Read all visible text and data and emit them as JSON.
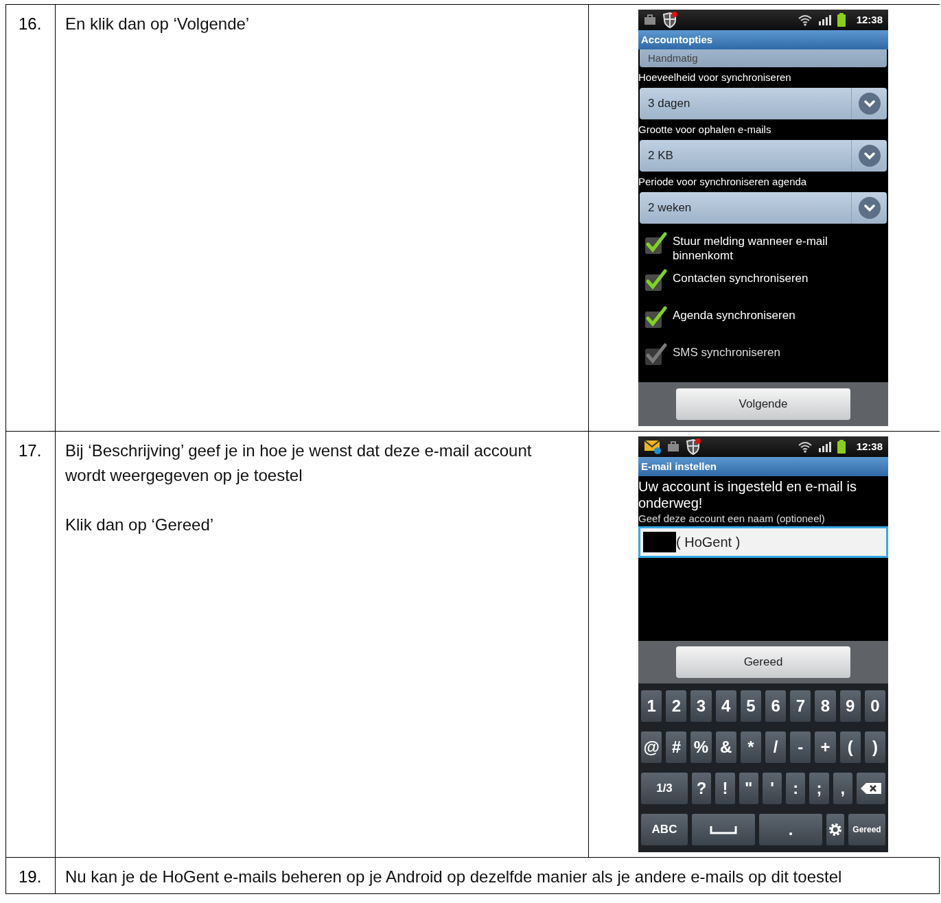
{
  "steps": [
    {
      "number": "16.",
      "paragraphs": [
        "En klik dan op ‘Volgende’"
      ],
      "phone": {
        "kind": "options",
        "time": "12:38",
        "notification_mail": false,
        "title": "Accountopties",
        "top_spinner": "Handmatig",
        "spinners": [
          {
            "label": "Hoeveelheid voor synchroniseren",
            "value": "3 dagen"
          },
          {
            "label": "Grootte voor ophalen e-mails",
            "value": "2 KB"
          },
          {
            "label": "Periode voor synchroniseren agenda",
            "value": "2 weken"
          }
        ],
        "checkboxes": [
          {
            "label": "Stuur melding wanneer e-mail binnenkomt",
            "checked": true,
            "disabled": false
          },
          {
            "label": "Contacten synchroniseren",
            "checked": true,
            "disabled": false
          },
          {
            "label": "Agenda synchroniseren",
            "checked": true,
            "disabled": false
          },
          {
            "label": "SMS synchroniseren",
            "checked": true,
            "disabled": true
          }
        ],
        "button": "Volgende"
      }
    },
    {
      "number": "17.",
      "paragraphs": [
        "Bij ‘Beschrijving’ geef je in hoe je wenst dat deze e-mail account wordt weergegeven op je toestel",
        "Klik dan op ‘Gereed’"
      ],
      "phone": {
        "kind": "name",
        "time": "12:38",
        "notification_mail": true,
        "title": "E-mail instellen",
        "message": "Uw account is ingesteld en e-mail is onderweg!",
        "field_label": "Geef deze account een naam (optioneel)",
        "field_value": "( HoGent )",
        "button": "Gereed",
        "keyboard": [
          [
            {
              "kind": "char",
              "label": "1"
            },
            {
              "kind": "char",
              "label": "2"
            },
            {
              "kind": "char",
              "label": "3"
            },
            {
              "kind": "char",
              "label": "4"
            },
            {
              "kind": "char",
              "label": "5"
            },
            {
              "kind": "char",
              "label": "6"
            },
            {
              "kind": "char",
              "label": "7"
            },
            {
              "kind": "char",
              "label": "8"
            },
            {
              "kind": "char",
              "label": "9"
            },
            {
              "kind": "char",
              "label": "0"
            }
          ],
          [
            {
              "kind": "char",
              "label": "@"
            },
            {
              "kind": "char",
              "label": "#"
            },
            {
              "kind": "char",
              "label": "%"
            },
            {
              "kind": "char",
              "label": "&"
            },
            {
              "kind": "char",
              "label": "*"
            },
            {
              "kind": "char",
              "label": "/"
            },
            {
              "kind": "char",
              "label": "-"
            },
            {
              "kind": "char",
              "label": "+"
            },
            {
              "kind": "char",
              "label": "("
            },
            {
              "kind": "char",
              "label": ")"
            }
          ],
          [
            {
              "kind": "mode",
              "label": "1/3"
            },
            {
              "kind": "char",
              "label": "?"
            },
            {
              "kind": "char",
              "label": "!"
            },
            {
              "kind": "char",
              "label": "\""
            },
            {
              "kind": "char",
              "label": "'"
            },
            {
              "kind": "char",
              "label": ":"
            },
            {
              "kind": "char",
              "label": ";"
            },
            {
              "kind": "char",
              "label": ","
            },
            {
              "kind": "backspace"
            }
          ],
          [
            {
              "kind": "mode",
              "label": "ABC"
            },
            {
              "kind": "space"
            },
            {
              "kind": "char",
              "label": "."
            },
            {
              "kind": "settings"
            },
            {
              "kind": "done",
              "label": "Gereed"
            }
          ]
        ]
      }
    },
    {
      "number": "19.",
      "paragraphs": [
        "Nu kan je de HoGent e-mails beheren op je Android op dezelfde manier als je andere e-mails op dit toestel"
      ]
    }
  ]
}
